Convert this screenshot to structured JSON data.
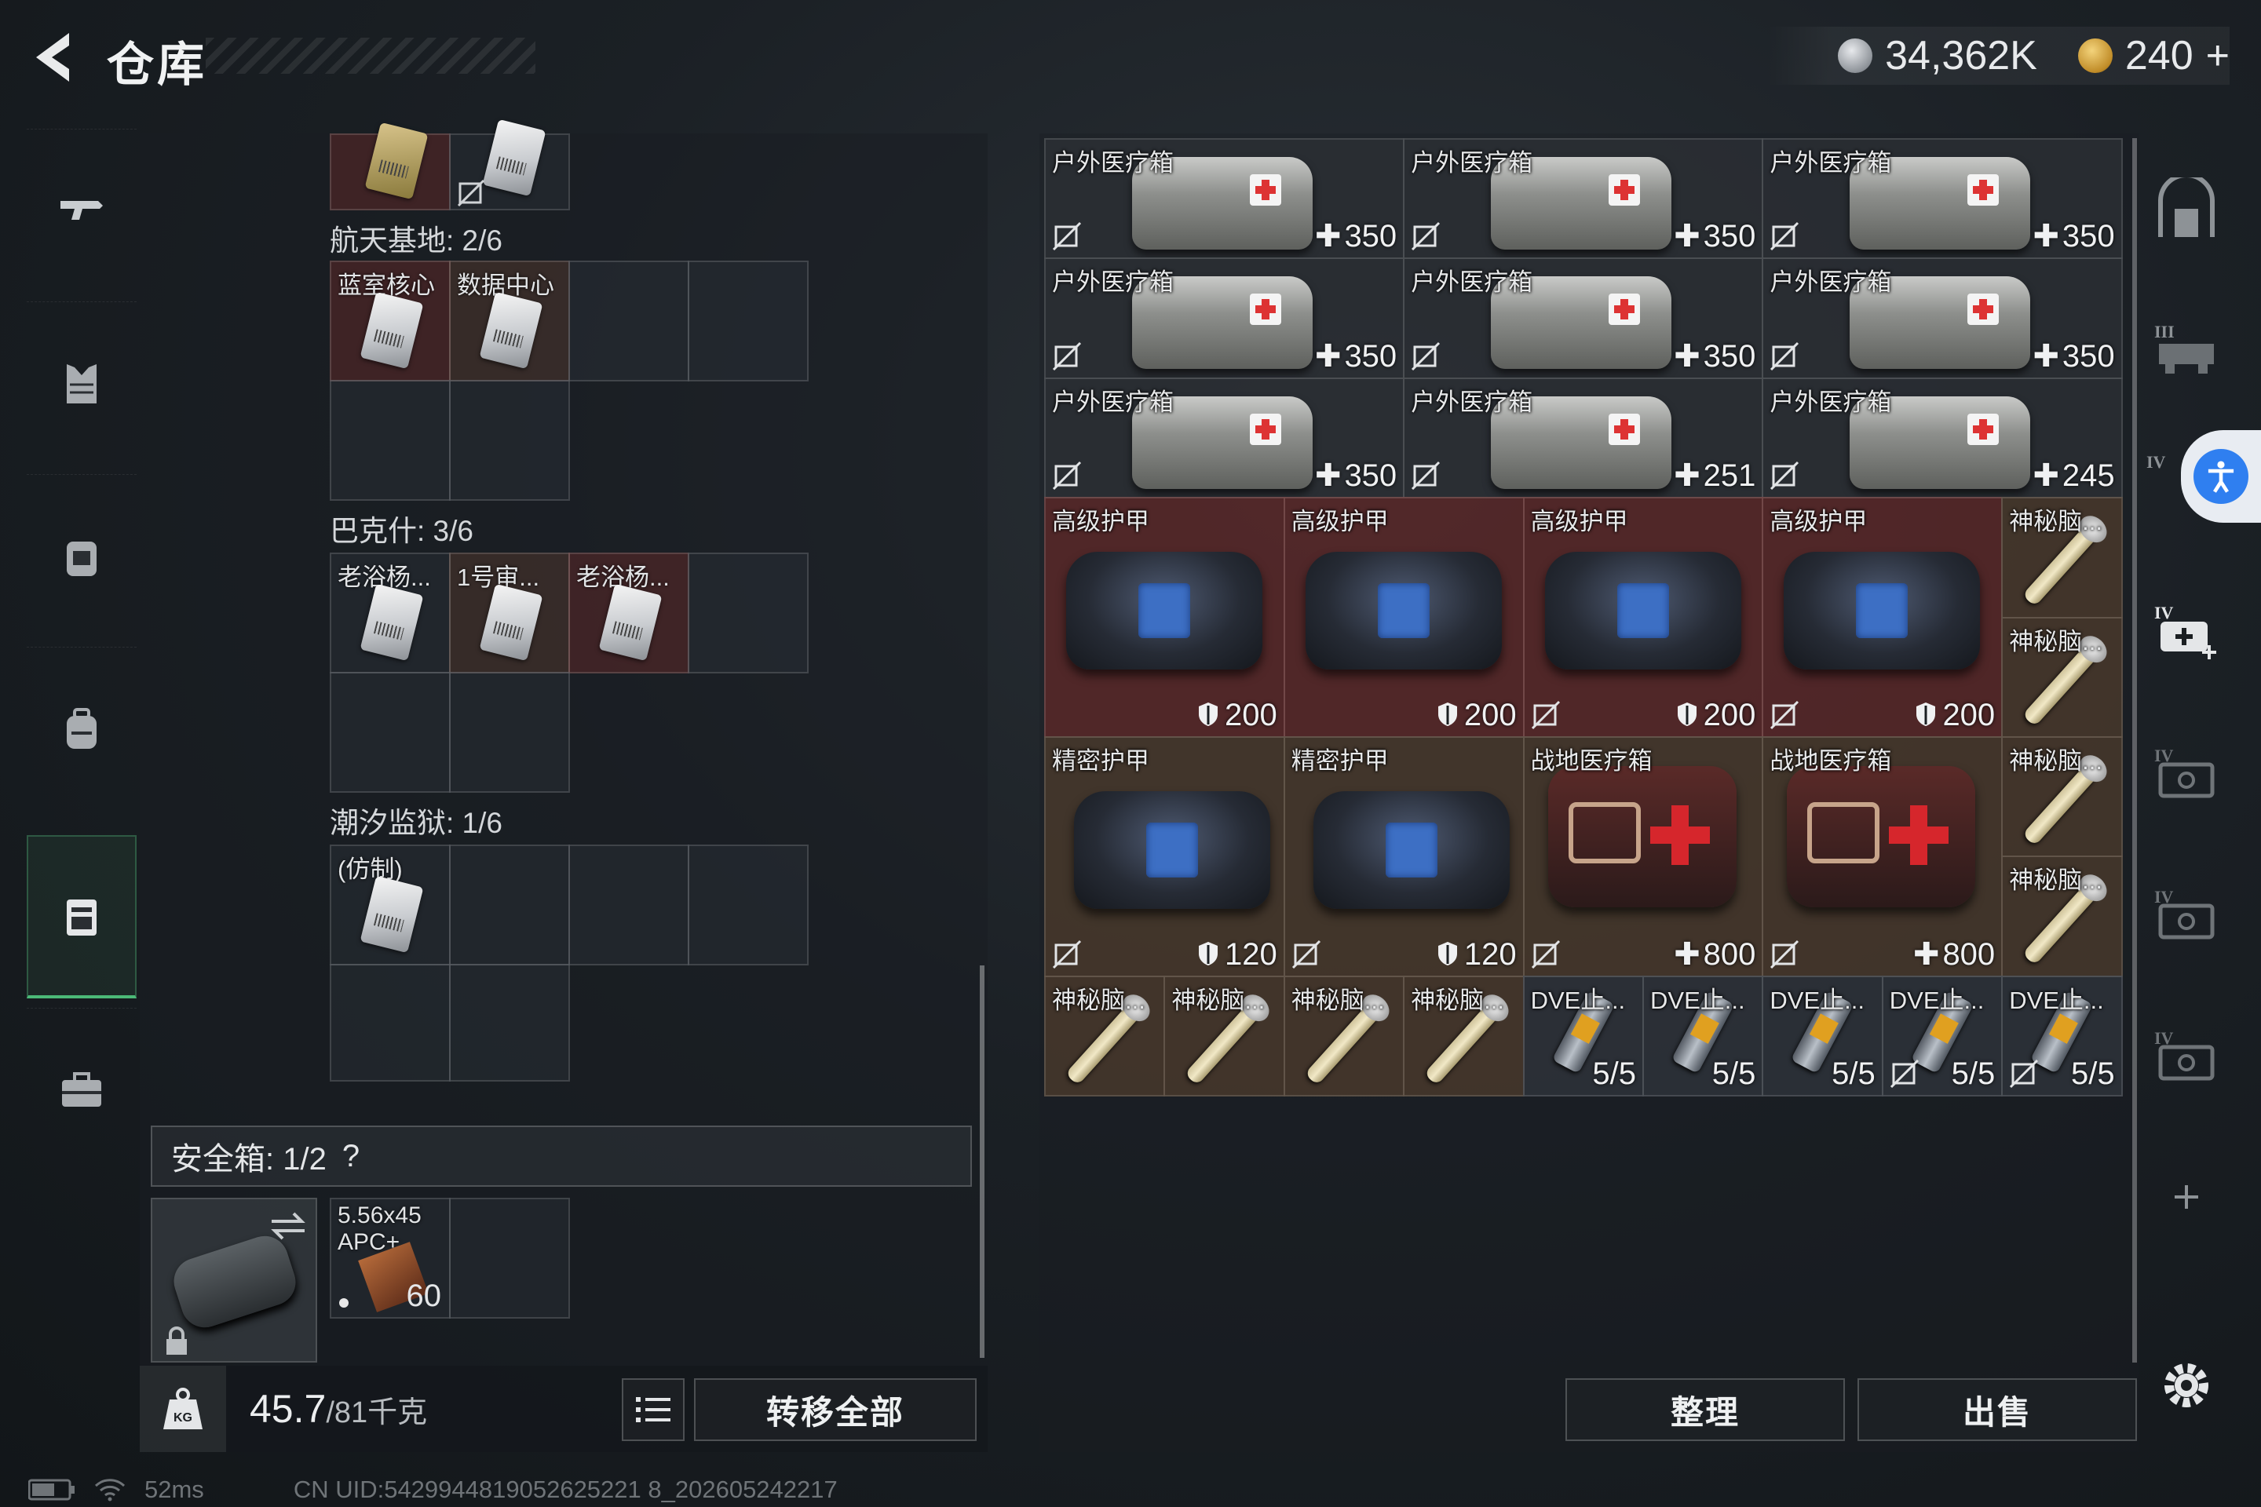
{
  "header": {
    "title": "仓库"
  },
  "currency": {
    "silver": "34,362K",
    "gold": "240",
    "gold_plus": "+"
  },
  "left_nav": [
    "weapon",
    "armor-vest",
    "chest-rig",
    "backpack",
    "container",
    "briefcase"
  ],
  "left_panel": {
    "groups": [
      {
        "label": "航天基地: 2/6",
        "items": [
          "蓝室核心",
          "数据中心"
        ]
      },
      {
        "label": "巴克什: 3/6",
        "items": [
          "老浴杨...",
          "1号审...",
          "老浴杨..."
        ]
      },
      {
        "label": "潮汐监狱: 1/6",
        "items": [
          "(仿制)"
        ]
      }
    ],
    "safe_box": {
      "label": "安全箱: 1/2",
      "help": "?"
    },
    "ammo": {
      "name": "5.56x45 APC+",
      "count": "60"
    },
    "weight": {
      "current": "45.7",
      "max": "/81千克"
    },
    "transfer_all": "转移全部"
  },
  "stash": {
    "medkits": [
      {
        "name": "户外医疗箱",
        "value": "350"
      },
      {
        "name": "户外医疗箱",
        "value": "350"
      },
      {
        "name": "户外医疗箱",
        "value": "350"
      },
      {
        "name": "户外医疗箱",
        "value": "350"
      },
      {
        "name": "户外医疗箱",
        "value": "350"
      },
      {
        "name": "户外医疗箱",
        "value": "350"
      },
      {
        "name": "户外医疗箱",
        "value": "350"
      },
      {
        "name": "户外医疗箱",
        "value": "251"
      },
      {
        "name": "户外医疗箱",
        "value": "245"
      }
    ],
    "armors_high": [
      {
        "name": "高级护甲",
        "value": "200"
      },
      {
        "name": "高级护甲",
        "value": "200"
      },
      {
        "name": "高级护甲",
        "value": "200"
      },
      {
        "name": "高级护甲",
        "value": "200"
      }
    ],
    "armors_precise": [
      {
        "name": "精密护甲",
        "value": "120"
      },
      {
        "name": "精密护甲",
        "value": "120"
      }
    ],
    "field_kits": [
      {
        "name": "战地医疗箱",
        "value": "800"
      },
      {
        "name": "战地医疗箱",
        "value": "800"
      }
    ],
    "syringes": [
      "神秘脑...",
      "神秘脑...",
      "神秘脑...",
      "神秘脑...",
      "神秘脑...",
      "神秘脑...",
      "神秘脑...",
      "神秘脑..."
    ],
    "injectors": [
      {
        "name": "DVE止...",
        "value": "5/5"
      },
      {
        "name": "DVE止...",
        "value": "5/5"
      },
      {
        "name": "DVE止...",
        "value": "5/5"
      },
      {
        "name": "DVE止...",
        "value": "5/5"
      },
      {
        "name": "DVE止...",
        "value": "5/5"
      }
    ]
  },
  "buttons": {
    "sort": "整理",
    "sell": "出售"
  },
  "status": {
    "ping": "52ms",
    "uid": "CN UID:5429944819052625221 8_202605242217"
  },
  "colors": {
    "accent_green": "#4bb977",
    "accessibility_blue": "#2f7ff0"
  }
}
